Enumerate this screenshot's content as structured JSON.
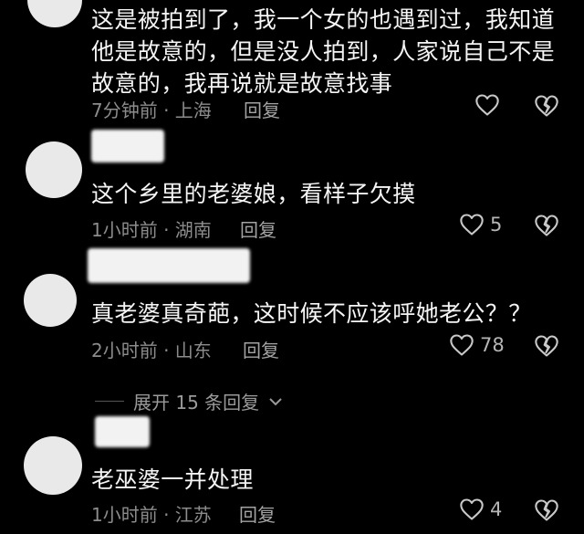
{
  "comments": [
    {
      "lines": [
        "这是被拍到了，我一个女的也遇到过，我知道",
        "他是故意的，但是没人拍到，人家说自己不是",
        "故意的，我再说就是故意找事"
      ],
      "meta": "7分钟前 · 上海",
      "reply": "回复",
      "likes": ""
    },
    {
      "lines": [
        "这个乡里的老婆娘，看样子欠摸"
      ],
      "meta": "1小时前 · 湖南",
      "reply": "回复",
      "likes": "5"
    },
    {
      "lines": [
        "真老婆真奇葩，这时候不应该呼她老公？？"
      ],
      "meta": "2小时前 · 山东",
      "reply": "回复",
      "likes": "78"
    },
    {
      "lines": [
        "老巫婆一并处理"
      ],
      "meta": "1小时前 · 江苏",
      "reply": "回复",
      "likes": "4"
    }
  ],
  "expand_label": "展开 15 条回复",
  "icons": {
    "like": "heart-outline-icon",
    "dislike": "broken-heart-icon",
    "expand": "chevron-down-icon"
  },
  "colors": {
    "background": "#000000",
    "text": "#f5f5f5",
    "meta": "#8c8c8c"
  }
}
